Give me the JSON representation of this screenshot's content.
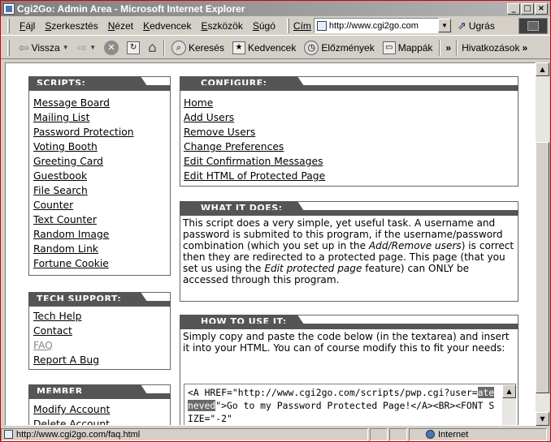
{
  "window": {
    "title": "Cgi2Go: Admin Area - Microsoft Internet Explorer",
    "minimize": "_",
    "maximize": "□",
    "close": "×"
  },
  "menu": {
    "items": [
      "Fájl",
      "Szerkesztés",
      "Nézet",
      "Kedvencek",
      "Eszközök",
      "Súgó"
    ],
    "address_label": "Cím",
    "address_value": "http://www.cgi2go.com",
    "go_label": "Ugrás"
  },
  "toolbar": {
    "back": "Vissza",
    "search": "Keresés",
    "favorites": "Kedvencek",
    "history": "Előzmények",
    "folders": "Mappák",
    "links": "Hivatkozások",
    "overflow": "»"
  },
  "sidebar": {
    "scripts": {
      "title": "SCRIPTS:",
      "links": [
        "Message Board",
        "Mailing List",
        "Password Protection",
        "Voting Booth",
        "Greeting Card",
        "Guestbook",
        "File Search",
        "Counter",
        "Text Counter",
        "Random Image",
        "Random Link",
        "Fortune Cookie"
      ]
    },
    "tech_support": {
      "title": "TECH SUPPORT:",
      "links": [
        "Tech Help",
        "Contact",
        "FAQ",
        "Report A Bug"
      ]
    },
    "member_utilities": {
      "title": "MEMBER UTILITIES:",
      "links": [
        "Modify Account",
        "Delete Account"
      ]
    }
  },
  "configure": {
    "title": "CONFIGURE:",
    "links": [
      "Home",
      "Add Users",
      "Remove Users",
      "Change Preferences",
      "Edit Confirmation Messages",
      "Edit HTML of Protected Page"
    ]
  },
  "what_it_does": {
    "title": "WHAT IT DOES:",
    "text_1": "This script does a very simple, yet useful task. A username and password is submited to this program, if the username/password combination (which you set up in the ",
    "italic_1": "Add/Remove users",
    "text_2": ") is correct then they are redirected to a protected page. This page (that you set us using the ",
    "italic_2": "Edit protected page",
    "text_3": " feature) can ONLY be accessed through this program."
  },
  "how_to_use": {
    "title": "HOW TO USE IT:",
    "text": "Simply copy and paste the code below (in the textarea) and insert it into your HTML. You can of course modify this to fit your needs:",
    "code_before": "<A HREF=\"http://www.cgi2go.com/scripts/pwp.cgi?user=",
    "code_highlight": "ateneved",
    "code_after": "\">Go to my Password Protected Page!</A><BR><FONT SIZE=\"-2\""
  },
  "status": {
    "url": "http://www.cgi2go.com/faq.html",
    "zone": "Internet"
  }
}
